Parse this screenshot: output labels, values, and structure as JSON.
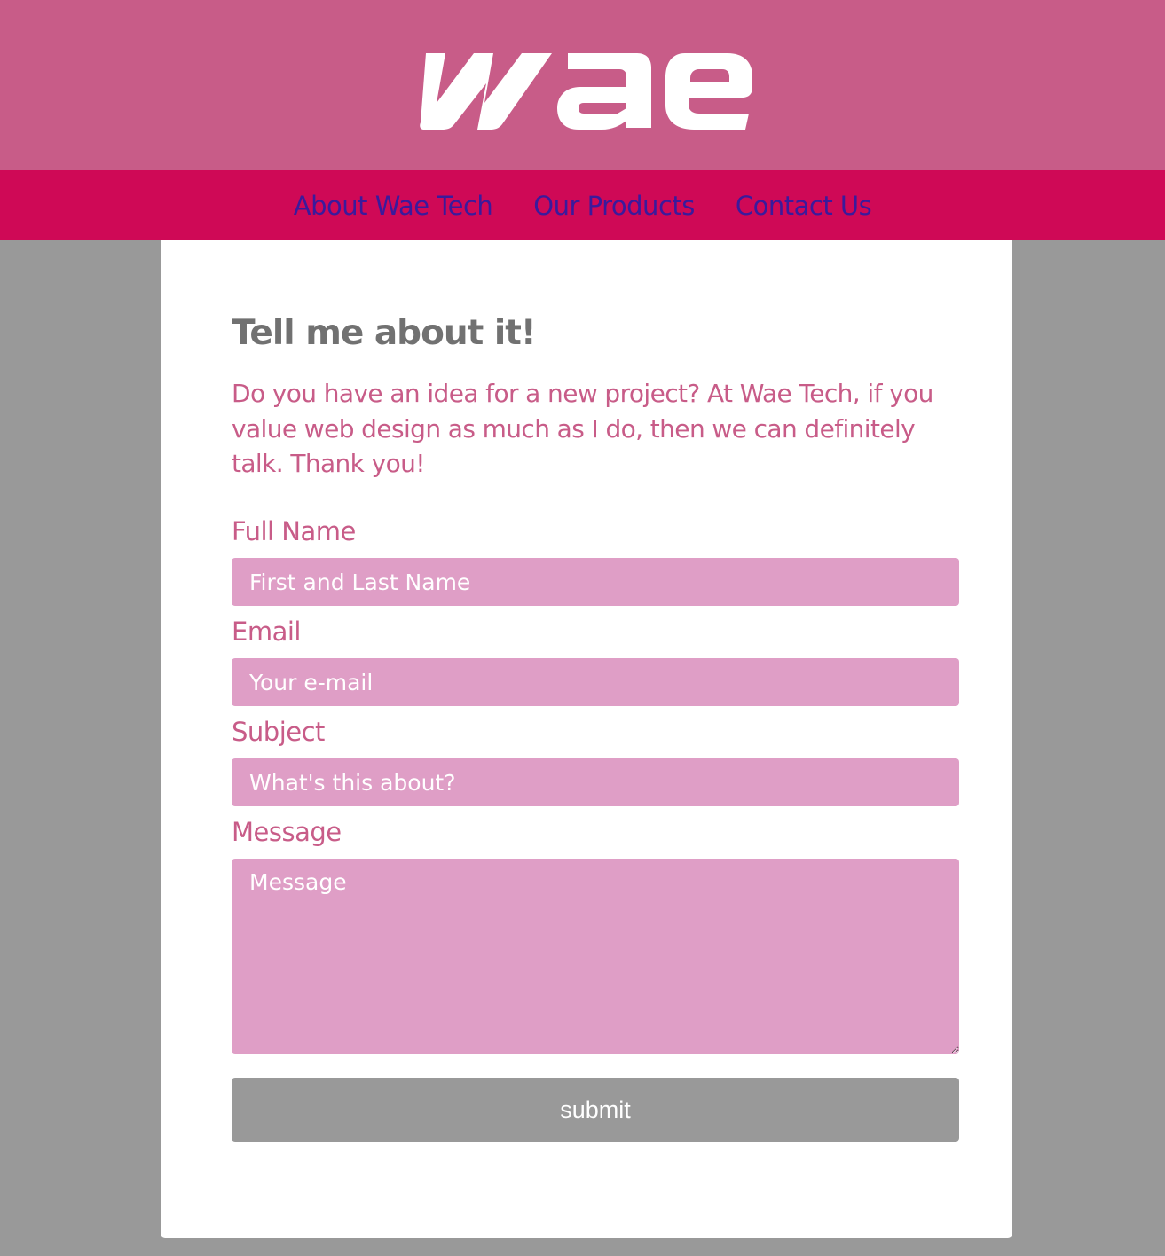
{
  "nav": {
    "items": [
      {
        "label": "About Wae Tech"
      },
      {
        "label": "Our Products"
      },
      {
        "label": "Contact Us"
      }
    ]
  },
  "logo": {
    "text": "wae"
  },
  "main": {
    "heading": "Tell me about it!",
    "intro": "Do you have an idea for a new project? At Wae Tech, if you value web design as much as I do, then we can definitely talk. Thank you!"
  },
  "form": {
    "full_name": {
      "label": "Full Name",
      "placeholder": "First and Last Name",
      "value": ""
    },
    "email": {
      "label": "Email",
      "placeholder": "Your e-mail",
      "value": ""
    },
    "subject": {
      "label": "Subject",
      "placeholder": "What's this about?",
      "value": ""
    },
    "message": {
      "label": "Message",
      "placeholder": "Message",
      "value": ""
    },
    "submit_label": "submit"
  },
  "colors": {
    "header": "#c85c88",
    "nav": "#cf0956",
    "nav_link": "#3a1a9c",
    "background": "#999999",
    "field": "#df9ec6",
    "heading": "#717171"
  }
}
